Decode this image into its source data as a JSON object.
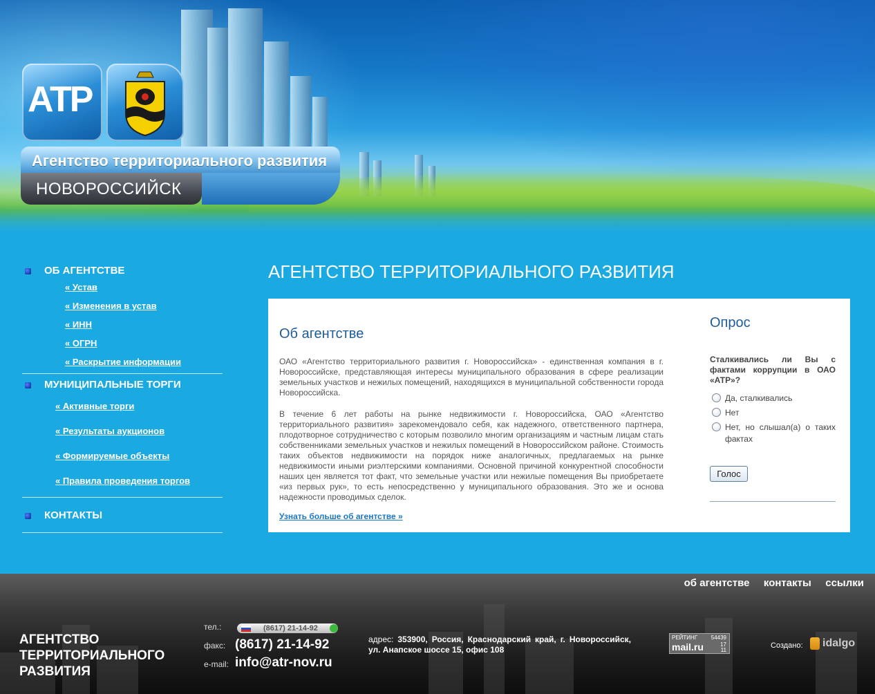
{
  "header": {
    "logo_abbr": "АТР",
    "logo_name": "Агентство территориального развития",
    "logo_city": "НОВОРОССИЙСК"
  },
  "sidebar": {
    "sections": [
      {
        "title": "ОБ АГЕНТСТВЕ",
        "links": [
          "« Устав",
          "« Изменения в устав",
          "« ИНН",
          "« ОГРН",
          "« Раскрытие информации"
        ]
      },
      {
        "title": "МУНИЦИПАЛЬНЫЕ ТОРГИ",
        "links": [
          "« Активные торги",
          "« Результаты аукционов",
          "« Формируемые объекты",
          "« Правила проведения торгов"
        ]
      },
      {
        "title": "КОНТАКТЫ",
        "links": []
      }
    ]
  },
  "main": {
    "page_title": "АГЕНТСТВО ТЕРРИТОРИАЛЬНОГО РАЗВИТИЯ",
    "about": {
      "title": "Об агентстве",
      "paragraph1": "ОАО «Агентство территориального развития г. Новороссийска» - единственная компания в г. Новороссийске, представляющая интересы муниципального образования в сфере реализации земельных участков и нежилых помещений, находящихся в муниципальной собственности города Новороссийска.",
      "paragraph2": "В течение 6 лет работы на рынке недвижимости г. Новороссийска, ОАО «Агентство территориального развития» зарекомендовало себя, как надежного, ответственного партнера, плодотворное сотрудничество с которым позволило многим организациям и частным лицам стать собственниками земельных участков и нежилых помещений в Новороссийском районе. Стоимость таких объектов недвижимости на порядок ниже аналогичных, предлагаемых на рынке недвижимости иными риэлтерскими компаниями. Основной причиной конкурентной способности наших цен является тот факт, что земельные участки или нежилые помещения Вы приобретаете «из первых рук», то есть непосредственно у муниципального образования. Это же и основа надежности проводимых сделок.",
      "more_link": "Узнать больше об агентстве »"
    },
    "poll": {
      "title": "Опрос",
      "question": "Сталкивались ли Вы с фактами коррупции в ОАО «АТР»?",
      "options": [
        "Да, сталкивались",
        "Нет",
        "Нет, но слышал(а) о таких фактах"
      ],
      "vote_label": "Голос"
    }
  },
  "footer": {
    "nav": [
      "об агентстве",
      "контакты",
      "ссылки"
    ],
    "brand_lines": [
      "АГЕНТСТВО",
      "ТЕРРИТОРИАЛЬНОГО",
      "РАЗВИТИЯ"
    ],
    "tel_label": "тел.:",
    "tel_widget": "(8617) 21-14-92",
    "fax_label": "факс:",
    "fax_value": "(8617) 21-14-92",
    "email_label": "e-mail:",
    "email_value": "info@atr-nov.ru",
    "address_label": "адрес:",
    "address_value": "353900, Россия, Краснодарский край, г. Новороссийск, ул. Анапское шоссе 15, офис 108",
    "counter": {
      "title": "РЕЙТИНГ",
      "count": "54439",
      "brand": "mail.ru",
      "n1": "17",
      "n2": "11"
    },
    "made_by_label": "Создано:",
    "studio_name": "idalgo"
  },
  "colors": {
    "page_bg": "#1aa9e0",
    "heading_blue": "#1d5c9a",
    "link_blue": "#1a78c8",
    "footer_dark": "#1c1c1c"
  }
}
